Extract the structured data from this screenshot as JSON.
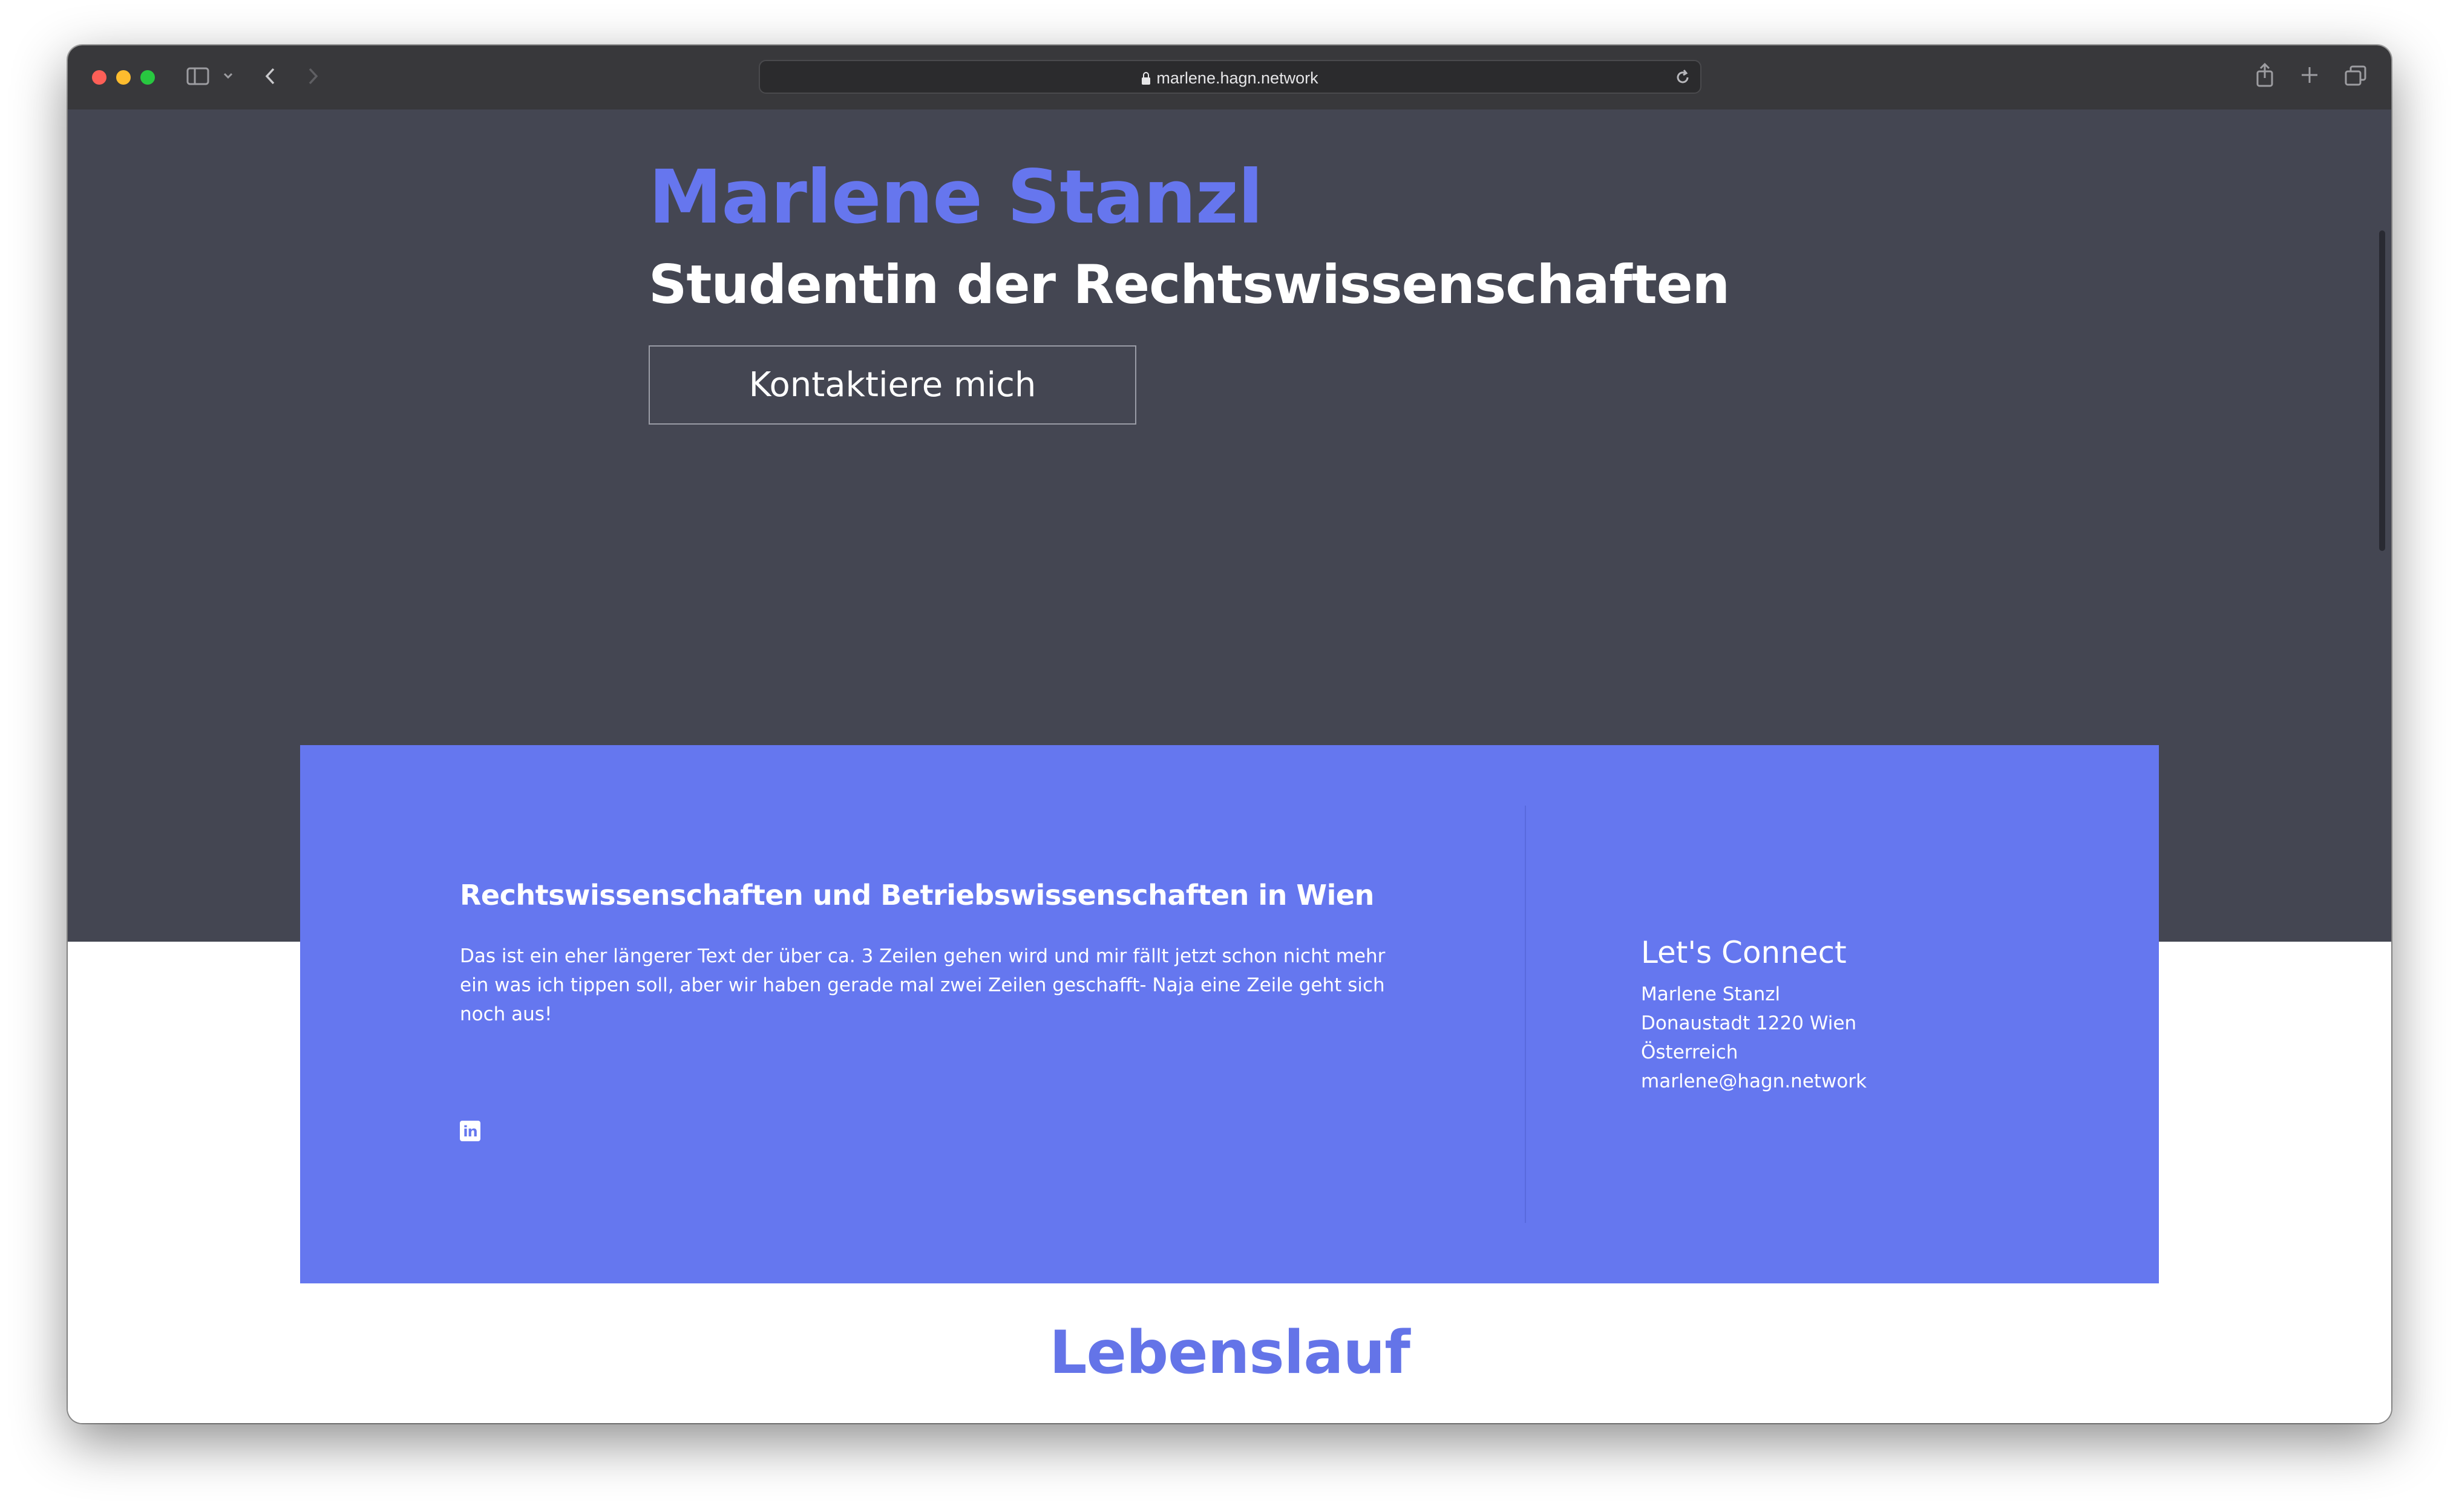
{
  "browser": {
    "url": "marlene.hagn.network"
  },
  "hero": {
    "name": "Marlene Stanzl",
    "subtitle": "Studentin der Rechtswissenschaften",
    "contact_button": "Kontaktiere mich"
  },
  "about": {
    "title": "Rechtswissenschaften und Betriebswissenschaften in Wien",
    "text": "Das ist ein eher längerer Text der über ca. 3 Zeilen gehen wird und mir fällt jetzt schon nicht mehr ein was ich tippen soll, aber wir haben gerade mal zwei Zeilen geschafft- Naja eine Zeile geht sich noch aus!",
    "social_icon": "linkedin-icon",
    "social_glyph": "in"
  },
  "connect": {
    "title": "Let's Connect",
    "name": "Marlene Stanzl",
    "address": "Donaustadt 1220 Wien",
    "country": "Österreich",
    "email": "marlene@hagn.network"
  },
  "cv": {
    "heading": "Lebenslauf"
  },
  "colors": {
    "accent": "#6577ef",
    "hero_background": "#444652",
    "toolbar": "#38383b"
  }
}
